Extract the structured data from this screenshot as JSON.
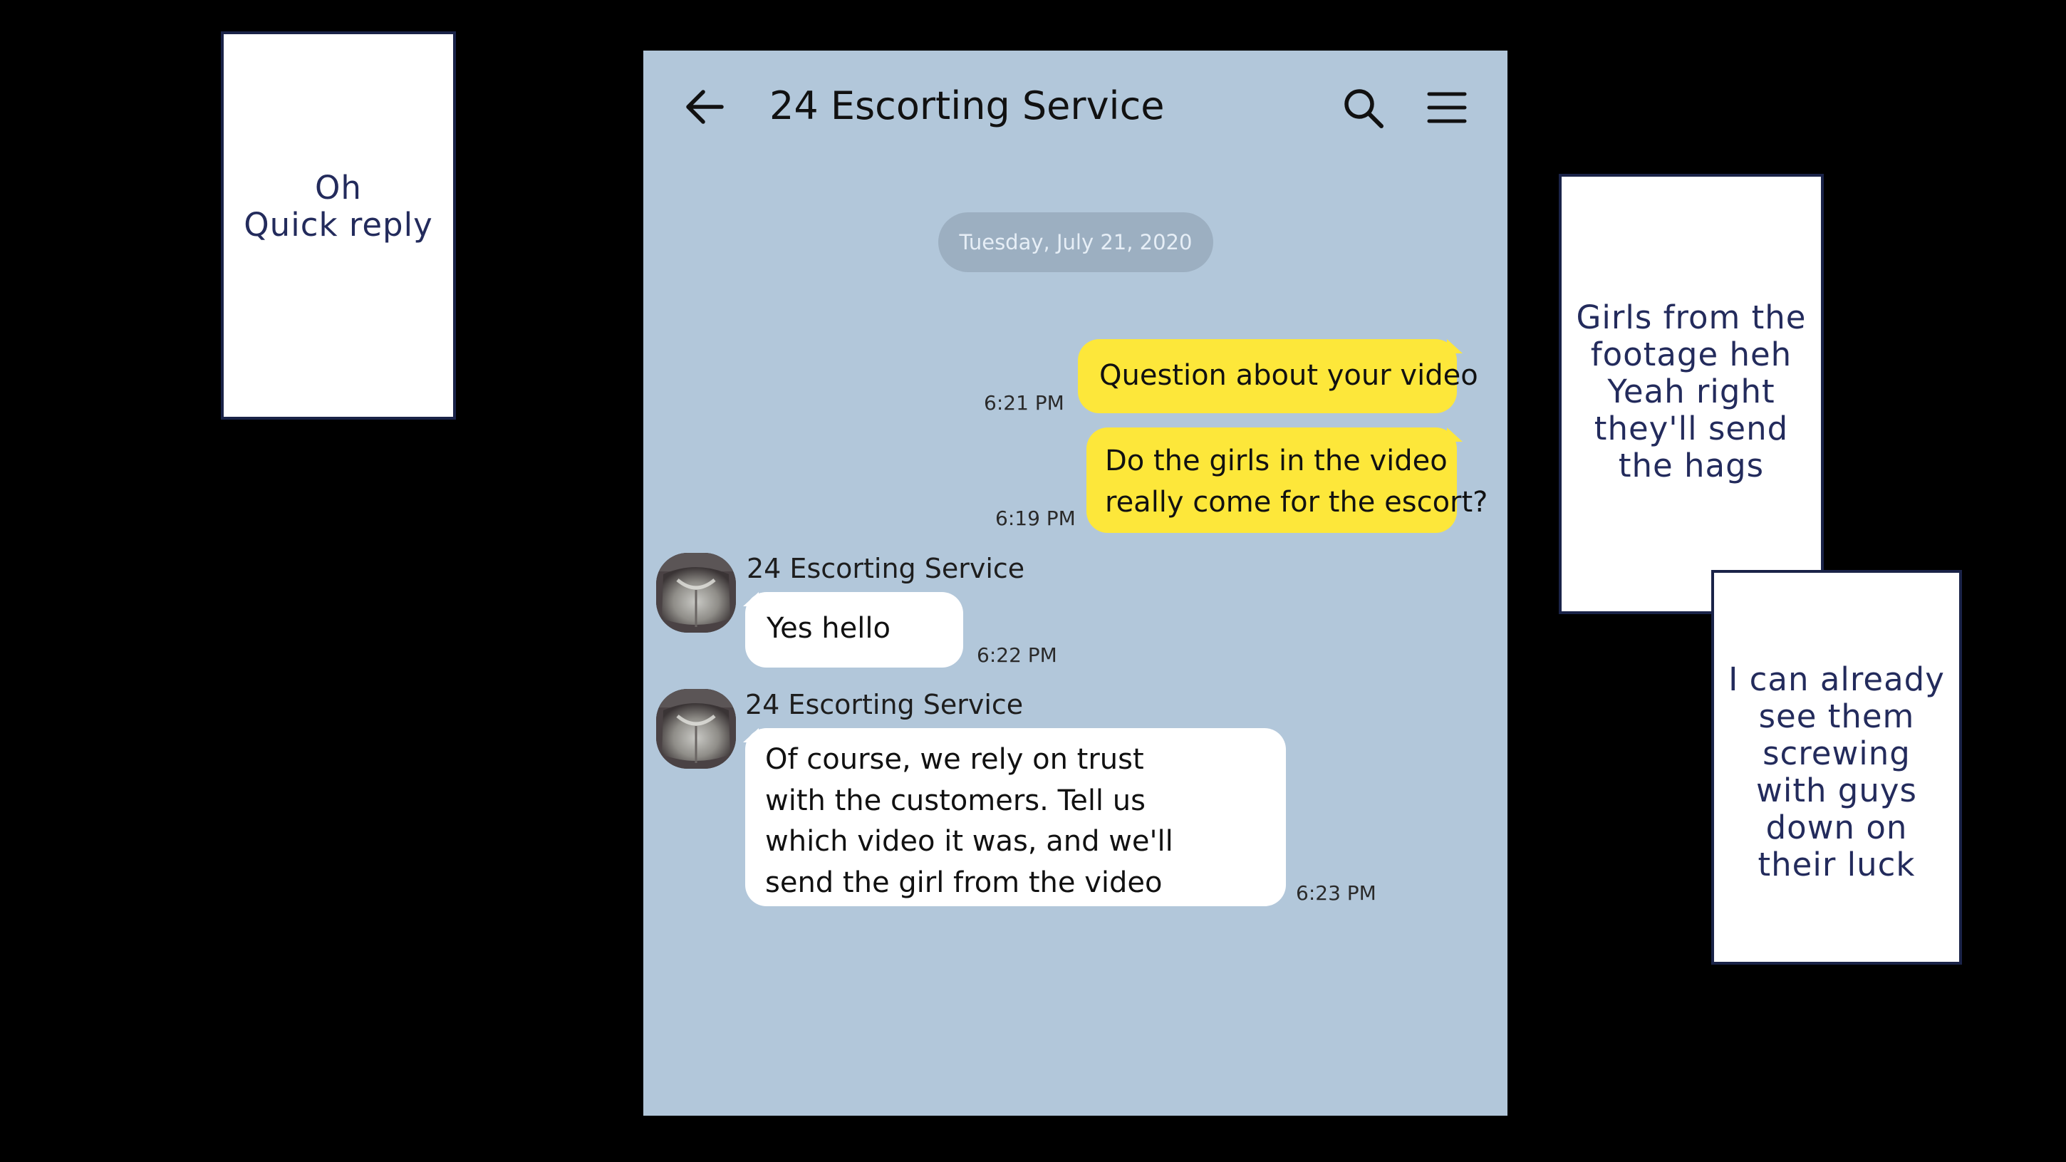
{
  "narration": {
    "box1": [
      "Oh",
      "Quick reply"
    ],
    "box2": [
      "Girls from the",
      "footage heh",
      "Yeah right",
      "they'll send",
      "the hags"
    ],
    "box3": [
      "I can already",
      "see them",
      "screwing",
      "with guys",
      "down on",
      "their luck"
    ]
  },
  "chat": {
    "title": "24 Escorting Service",
    "date_separator": "Tuesday, July 21, 2020",
    "messages": [
      {
        "direction": "sent",
        "lines": [
          "Question about your video"
        ],
        "time": "6:21 PM"
      },
      {
        "direction": "sent",
        "lines": [
          "Do the girls in the video",
          "really come for the escort?"
        ],
        "time": "6:19 PM"
      },
      {
        "direction": "received",
        "sender": "24 Escorting Service",
        "lines": [
          "Yes hello"
        ],
        "time": "6:22 PM"
      },
      {
        "direction": "received",
        "sender": "24 Escorting Service",
        "lines": [
          "Of course, we rely on trust",
          "with the customers. Tell us",
          "which video it was, and we'll",
          "send the girl from the video"
        ],
        "time": "6:23 PM"
      }
    ]
  },
  "icons": {
    "back": "arrow-left-icon",
    "search": "search-icon",
    "menu": "hamburger-menu-icon"
  },
  "colors": {
    "chat_background": "#b2c7da",
    "sent_bubble": "#fde73a",
    "received_bubble": "#ffffff",
    "date_pill": "#9cafc1",
    "narration_text": "#232b5c"
  }
}
